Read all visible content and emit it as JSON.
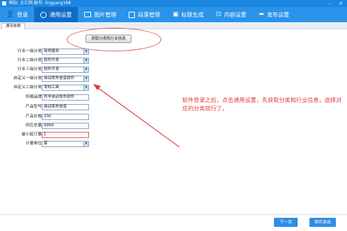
{
  "window": {
    "title": "网站: 企汇网,账号: lingyang168"
  },
  "menubar": {
    "items": [
      {
        "label": "登录",
        "icon": "user-icon"
      },
      {
        "label": "通用设置",
        "icon": "gear-icon"
      },
      {
        "label": "图片管理",
        "icon": "image-icon"
      },
      {
        "label": "段落管理",
        "icon": "paragraph-icon"
      },
      {
        "label": "标题生成",
        "icon": "heading-icon"
      },
      {
        "label": "内容设置",
        "icon": "content-icon"
      },
      {
        "label": "发布设置",
        "icon": "publish-icon"
      }
    ]
  },
  "tabstrip": {
    "tab_label": "通用参数"
  },
  "toolbar": {
    "fetch_label": "获取分类和行业信息"
  },
  "form": {
    "fields": [
      {
        "label": "行业一级分类",
        "value": "商务服务"
      },
      {
        "label": "行业二级分类",
        "value": "软件开发"
      },
      {
        "label": "行业三级分类",
        "value": "软件开发"
      },
      {
        "label": "自定义一级分类",
        "value": "自动发布信息软件"
      },
      {
        "label": "自定义二级分类",
        "value": "发帖工具"
      },
      {
        "label": "所属品牌",
        "value": "羚羊自动发布软件"
      },
      {
        "label": "产品型号",
        "value": "自动发布信息"
      },
      {
        "label": "产品价格",
        "value": "200"
      },
      {
        "label": "供应总量",
        "value": "9999"
      },
      {
        "label": "最小起订量",
        "value": "1"
      },
      {
        "label": "计量单位",
        "value": "套"
      }
    ]
  },
  "annotation": {
    "text": "软件登录之后，点击通用设置，先获取分类和行业信息，选择对应的分类就行了。"
  },
  "footer": {
    "prev_label": "下一页",
    "save_label": "保存退出"
  },
  "colors": {
    "titlebar": "#1a86e0",
    "menubar": "#2a93ea",
    "menu_active": "#0f6bc5",
    "annotation": "#e23b3b",
    "button": "#2f8de4"
  }
}
